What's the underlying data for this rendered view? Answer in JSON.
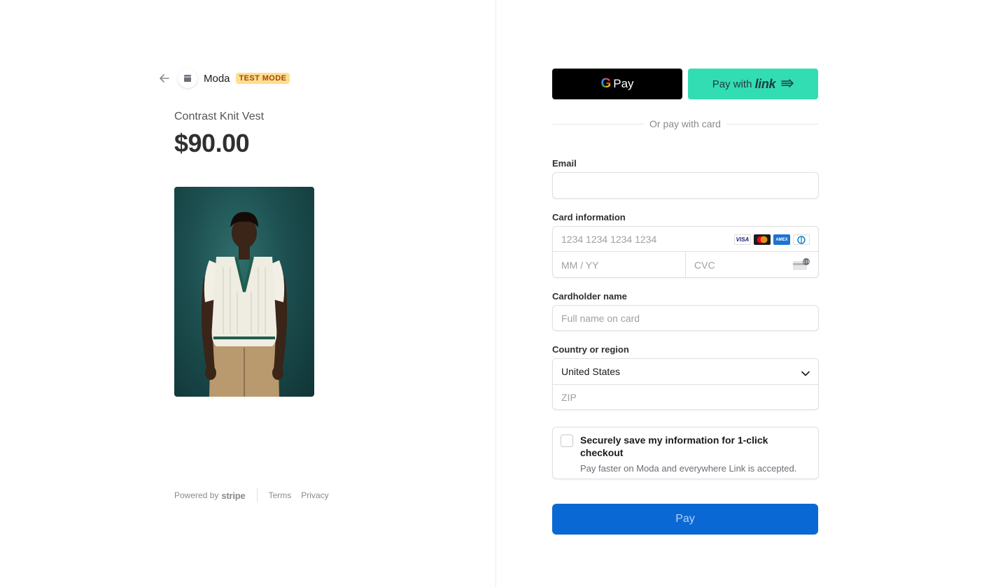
{
  "merchant": {
    "name": "Moda",
    "badge": "TEST MODE"
  },
  "product": {
    "name": "Contrast Knit Vest",
    "price": "$90.00",
    "image": "product-photo"
  },
  "footer": {
    "powered_by": "Powered by",
    "stripe": "stripe",
    "terms": "Terms",
    "privacy": "Privacy"
  },
  "wallets": {
    "gpay_g": "G",
    "gpay_label": "Pay",
    "link_prefix": "Pay with",
    "link_word": "link"
  },
  "divider_text": "Or pay with card",
  "form": {
    "email_label": "Email",
    "email_value": "",
    "card_label": "Card information",
    "card_number_placeholder": "1234 1234 1234 1234",
    "expiry_placeholder": "MM / YY",
    "cvc_placeholder": "CVC",
    "card_brands": [
      "VISA",
      "mastercard",
      "AMEX",
      "diners"
    ],
    "cardholder_label": "Cardholder name",
    "cardholder_placeholder": "Full name on card",
    "country_label": "Country or region",
    "country_value": "United States",
    "zip_placeholder": "ZIP"
  },
  "save_info": {
    "title": "Securely save my information for 1-click checkout",
    "subtitle": "Pay faster on Moda and everywhere Link is accepted.",
    "checked": false
  },
  "pay_button": "Pay",
  "colors": {
    "pay_blue": "#0a68d4",
    "link_green": "#33ddb3",
    "badge_bg": "#ffde92",
    "badge_text": "#a2470c"
  }
}
